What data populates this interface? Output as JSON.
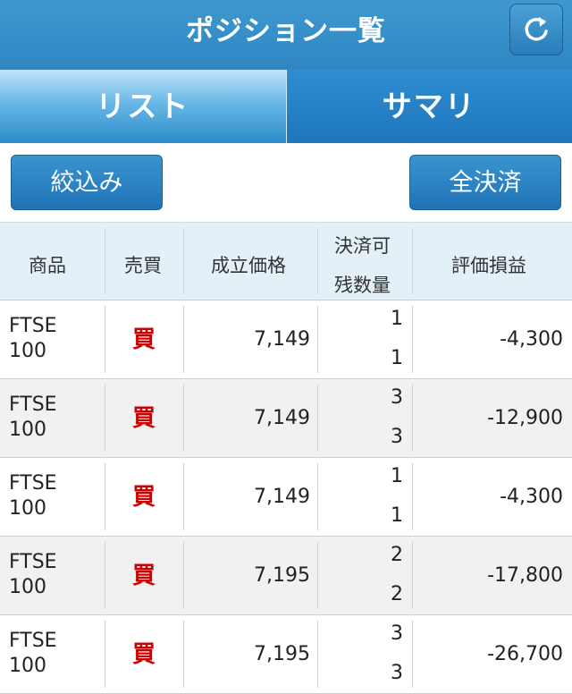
{
  "header": {
    "title": "ポジション一覧",
    "refresh_icon": "refresh-icon"
  },
  "tabs": [
    {
      "label": "リスト",
      "active": true
    },
    {
      "label": "サマリ",
      "active": false
    }
  ],
  "actions": {
    "filter_label": "絞込み",
    "close_all_label": "全決済"
  },
  "table": {
    "headers": {
      "product": "商品",
      "side": "売買",
      "price": "成立価格",
      "qty_line1": "決済可",
      "qty_line2": "残数量",
      "pl": "評価損益"
    },
    "rows": [
      {
        "product_line1": "FTSE",
        "product_line2": "100",
        "side": "買",
        "price": "7,149",
        "closable": "1",
        "remaining": "1",
        "pl": "-4,300"
      },
      {
        "product_line1": "FTSE",
        "product_line2": "100",
        "side": "買",
        "price": "7,149",
        "closable": "3",
        "remaining": "3",
        "pl": "-12,900"
      },
      {
        "product_line1": "FTSE",
        "product_line2": "100",
        "side": "買",
        "price": "7,149",
        "closable": "1",
        "remaining": "1",
        "pl": "-4,300"
      },
      {
        "product_line1": "FTSE",
        "product_line2": "100",
        "side": "買",
        "price": "7,195",
        "closable": "2",
        "remaining": "2",
        "pl": "-17,800"
      },
      {
        "product_line1": "FTSE",
        "product_line2": "100",
        "side": "買",
        "price": "7,195",
        "closable": "3",
        "remaining": "3",
        "pl": "-26,700"
      }
    ]
  },
  "colors": {
    "header_bg": "#2f86c3",
    "buy": "#cc0000",
    "row_alt": "#f1f1f1"
  }
}
